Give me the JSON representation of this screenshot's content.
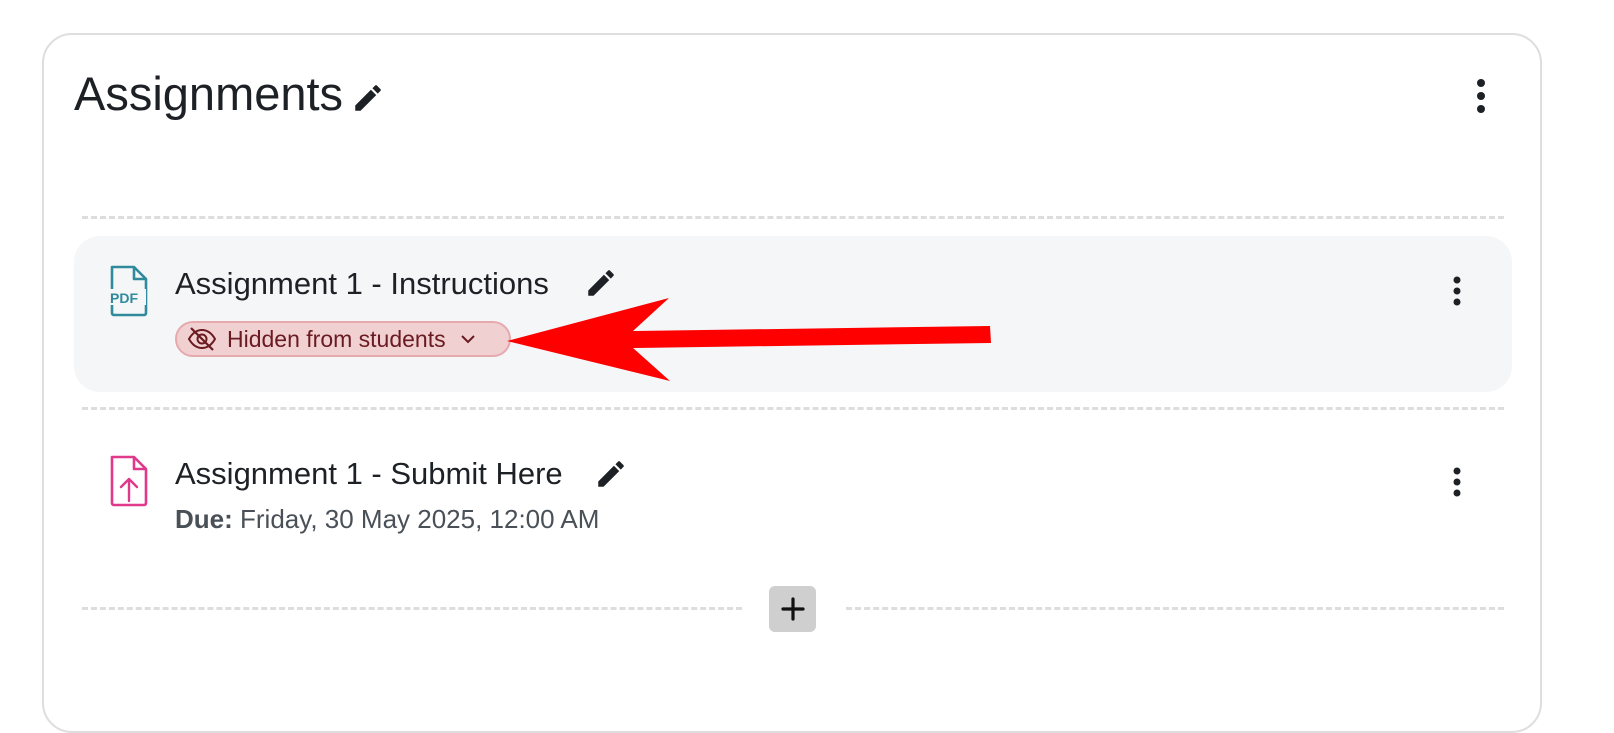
{
  "section": {
    "title": "Assignments"
  },
  "activities": [
    {
      "name": "Assignment 1 - Instructions",
      "type_icon": "pdf-file-icon",
      "type_icon_text": "PDF",
      "visibility_badge": "Hidden from students",
      "accent": "#2f8a9c"
    },
    {
      "name": "Assignment 1 - Submit Here",
      "type_icon": "assignment-upload-icon",
      "due_label": "Due:",
      "due_value": "Friday, 30 May 2025, 12:00 AM",
      "accent": "#e0388a"
    }
  ],
  "colors": {
    "badge_bg": "#f1d0d2",
    "badge_text": "#6a1a21",
    "annotation_arrow": "#ff0000",
    "hidden_row_bg": "#f5f6f8"
  },
  "icons": {
    "edit": "pencil-icon",
    "menu": "kebab-menu-icon",
    "hidden": "eye-slash-icon",
    "dropdown": "chevron-down-icon",
    "add": "plus-icon"
  }
}
